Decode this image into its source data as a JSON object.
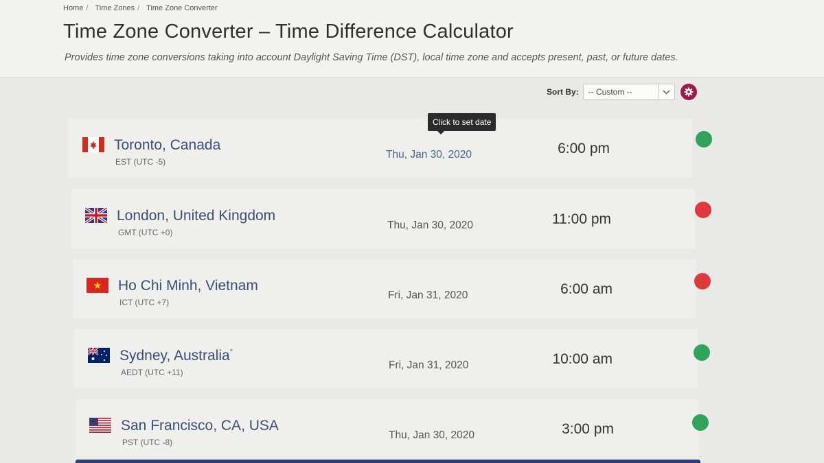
{
  "breadcrumb": [
    "Home",
    "Time Zones",
    "Time Zone Converter"
  ],
  "page": {
    "title": "Time Zone Converter – Time Difference Calculator",
    "subtitle": "Provides time zone conversions taking into account Daylight Saving Time (DST), local time zone and accepts present, past, or future dates."
  },
  "sort": {
    "label": "Sort By:",
    "selected": "-- Custom --"
  },
  "tooltip": "Click to set date",
  "colors": {
    "day": "#2ea359",
    "night": "#e0393b",
    "accent": "#a2164e",
    "link": "#3a4e76"
  },
  "rows": [
    {
      "city": "Toronto, Canada",
      "tz": "EST (UTC -5)",
      "date": "Thu, Jan 30, 2020",
      "time": "6:00 pm",
      "status": "day",
      "flag": "canada-flag-icon"
    },
    {
      "city": "London, United Kingdom",
      "tz": "GMT (UTC +0)",
      "date": "Thu, Jan 30, 2020",
      "time": "11:00 pm",
      "status": "night",
      "flag": "uk-flag-icon"
    },
    {
      "city": "Ho Chi Minh, Vietnam",
      "tz": "ICT (UTC +7)",
      "date": "Fri, Jan 31, 2020",
      "time": "6:00 am",
      "status": "night",
      "flag": "vietnam-flag-icon"
    },
    {
      "city": "Sydney, Australia",
      "city_mark": "*",
      "tz": "AEDT (UTC +11)",
      "date": "Fri, Jan 31, 2020",
      "time": "10:00 am",
      "status": "day",
      "flag": "australia-flag-icon"
    },
    {
      "city": "San Francisco, CA, USA",
      "tz": "PST (UTC -8)",
      "date": "Thu, Jan 30, 2020",
      "time": "3:00 pm",
      "status": "day",
      "flag": "usa-flag-icon"
    }
  ]
}
